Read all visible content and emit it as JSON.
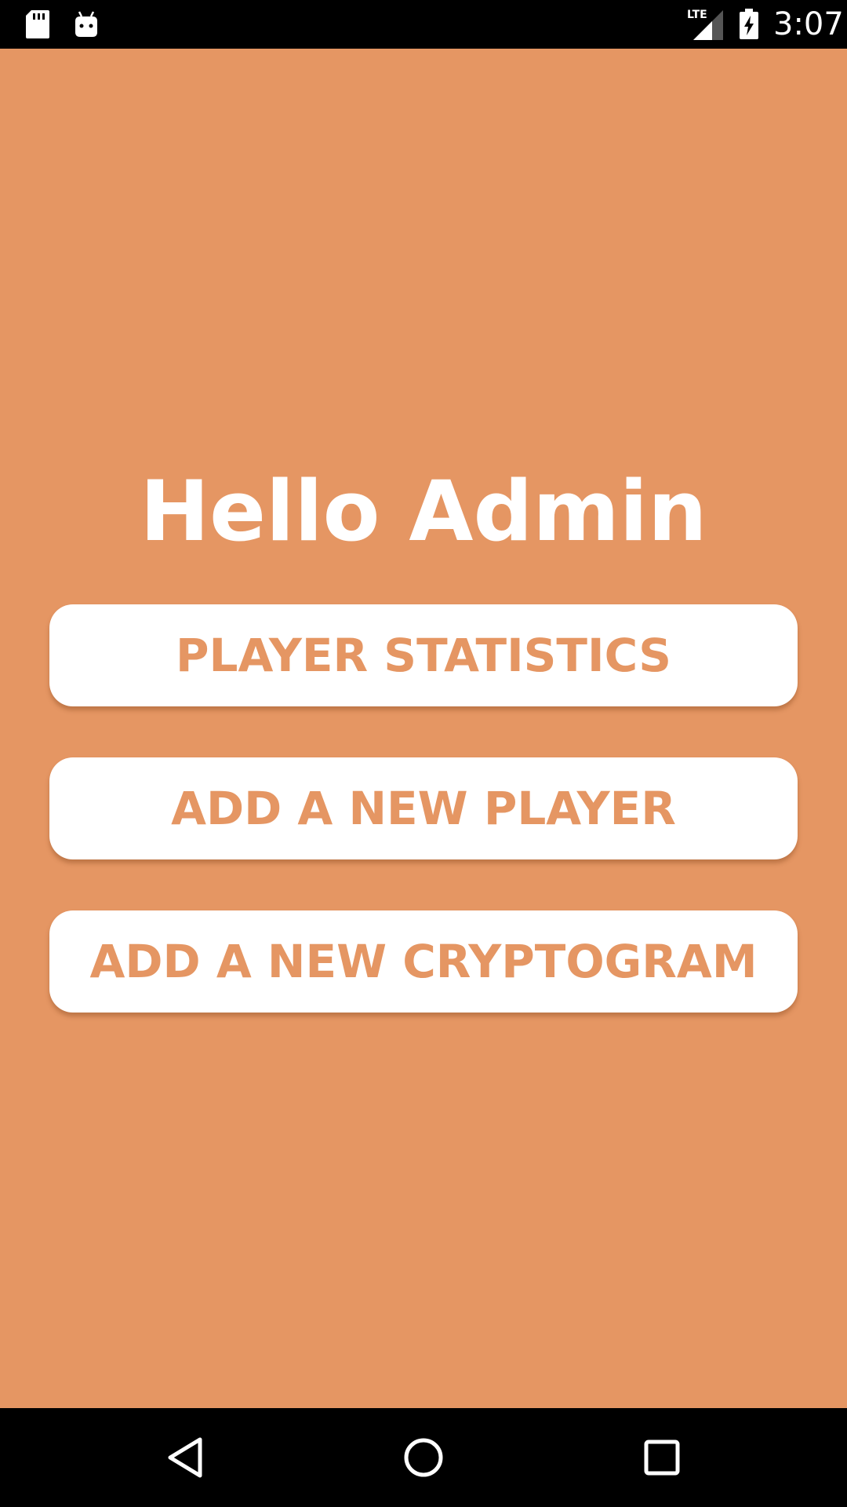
{
  "status_bar": {
    "icons": [
      "sd-card-icon",
      "android-icon",
      "lte-signal-icon",
      "battery-charging-icon"
    ],
    "network_label": "LTE",
    "time": "3:07"
  },
  "main": {
    "greeting": "Hello Admin",
    "buttons": [
      {
        "label": "PLAYER STATISTICS"
      },
      {
        "label": "ADD A NEW PLAYER"
      },
      {
        "label": "ADD A NEW CRYPTOGRAM"
      }
    ]
  },
  "nav_bar": {
    "icons": [
      "back-icon",
      "home-icon",
      "recents-icon"
    ]
  },
  "colors": {
    "background": "#e59663",
    "button_background": "#ffffff",
    "button_text": "#e59663",
    "bars": "#000000"
  }
}
